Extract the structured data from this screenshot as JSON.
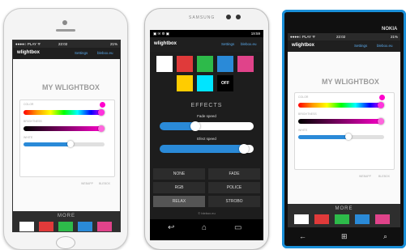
{
  "app": {
    "logo": "wlightbox",
    "nav_settings": "Settings",
    "nav_blebox": "blebox.eu",
    "heading": "MY WLIGHTBOX",
    "label_color": "COLOR",
    "label_brightness": "BRIGHTNESS",
    "label_white": "WHITE",
    "footer_left": "WEBAPP",
    "footer_right": "BLEBOX",
    "more_label": "MORE"
  },
  "iphone": {
    "carrier": "●●●●○ PLAY ᯤ",
    "time": "22:02",
    "battery": "21%"
  },
  "samsung": {
    "brand": "SAMSUNG",
    "time": "19:59",
    "effects_heading": "EFFECTS",
    "fade_speed": "Fade speed",
    "effect_speed": "Efect speed",
    "off_label": "OFF",
    "effect_buttons": [
      "NONE",
      "FADE",
      "RGB",
      "POLICE",
      "RELAX",
      "STROBO"
    ],
    "selected_effect": "RELAX",
    "copyright": "© blebox.eu"
  },
  "nokia": {
    "brand": "NOKIA",
    "carrier": "●●●●○ PLAY ᯤ",
    "time": "22:02",
    "battery": "21%"
  },
  "colors": {
    "swatches": [
      "#ffffff",
      "#e03a3a",
      "#2dba4a",
      "#2a8ad8",
      "#e0438a"
    ],
    "samsung_swatches": [
      "#ffffff",
      "#e03a3a",
      "#2dba4a",
      "#2a8ad8",
      "#e0438a",
      "#ffcc00",
      "#00e5ff"
    ],
    "accent": "#2a8ad8",
    "magenta": "#ff00cc"
  },
  "sliders": {
    "color_level": 0.94,
    "brightness_level": 0.96,
    "white_level": 0.6,
    "fade_speed_level": 0.35,
    "effect_speed_level": 0.9
  }
}
